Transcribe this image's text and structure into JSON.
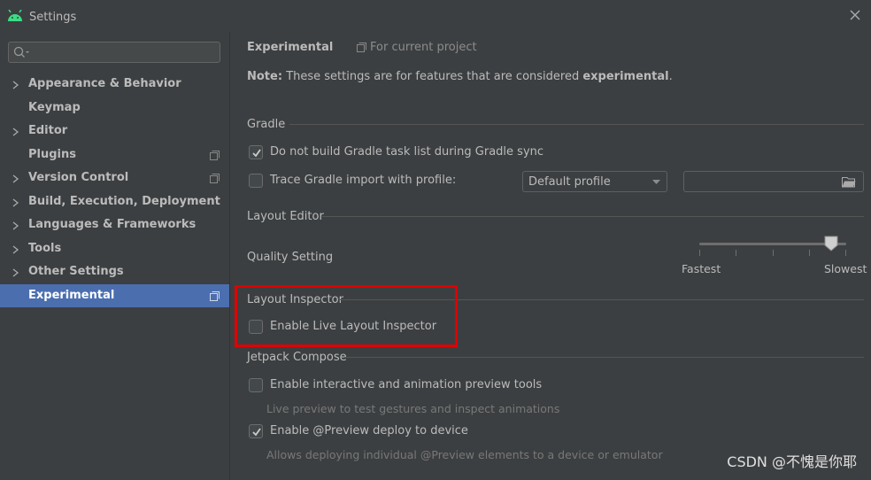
{
  "window": {
    "title": "Settings",
    "icons": {
      "logo": "android-icon",
      "close": "close-icon"
    }
  },
  "sidebar": {
    "search": {
      "value": "",
      "placeholder": ""
    },
    "items": [
      {
        "label": "Appearance & Behavior",
        "expandable": true,
        "project_scope": false
      },
      {
        "label": "Keymap",
        "expandable": false,
        "project_scope": false
      },
      {
        "label": "Editor",
        "expandable": true,
        "project_scope": false
      },
      {
        "label": "Plugins",
        "expandable": false,
        "project_scope": true
      },
      {
        "label": "Version Control",
        "expandable": true,
        "project_scope": true
      },
      {
        "label": "Build, Execution, Deployment",
        "expandable": true,
        "project_scope": false
      },
      {
        "label": "Languages & Frameworks",
        "expandable": true,
        "project_scope": false
      },
      {
        "label": "Tools",
        "expandable": true,
        "project_scope": false
      },
      {
        "label": "Other Settings",
        "expandable": true,
        "project_scope": false
      },
      {
        "label": "Experimental",
        "expandable": false,
        "project_scope": true,
        "selected": true
      }
    ]
  },
  "main": {
    "title": "Experimental",
    "scope": "For current project",
    "note": {
      "prefix": "Note:",
      "text": "These settings are for features that are considered",
      "bold": "experimental",
      "suffix": "."
    },
    "gradle": {
      "header": "Gradle",
      "do_not_build": {
        "label": "Do not build Gradle task list during Gradle sync",
        "checked": true
      },
      "trace": {
        "label": "Trace Gradle import with profile:",
        "checked": false
      },
      "profile_select": "Default profile",
      "profile_path": ""
    },
    "layout_editor": {
      "header": "Layout Editor",
      "quality_label": "Quality Setting",
      "slider_min_label": "Fastest",
      "slider_max_label": "Slowest",
      "slider_value_fraction": 0.88
    },
    "layout_inspector": {
      "header": "Layout Inspector",
      "enable_live": {
        "label": "Enable Live Layout Inspector",
        "checked": false
      }
    },
    "compose": {
      "header": "Jetpack Compose",
      "interactive": {
        "label": "Enable interactive and animation preview tools",
        "checked": false,
        "hint": "Live preview to test gestures and inspect animations"
      },
      "deploy": {
        "label": "Enable @Preview deploy to device",
        "checked": true,
        "hint": "Allows deploying individual @Preview elements to a device or emulator"
      }
    }
  },
  "watermark": "CSDN @不愧是你耶",
  "colors": {
    "accent": "#4b6eaf",
    "background": "#3c3f41",
    "highlight": "#e00000",
    "android_green": "#3ddc84"
  }
}
